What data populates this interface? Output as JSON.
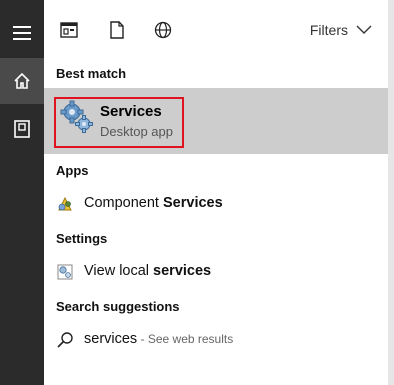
{
  "rail": {
    "items": [
      {
        "name": "menu",
        "icon": "hamburger-icon"
      },
      {
        "name": "home",
        "icon": "home-icon"
      },
      {
        "name": "documents",
        "icon": "document-icon"
      }
    ]
  },
  "topbar": {
    "tabs": [
      {
        "icon": "apps-icon"
      },
      {
        "icon": "documents-icon"
      },
      {
        "icon": "web-globe-icon"
      }
    ],
    "filters_label": "Filters"
  },
  "sections": {
    "best_match": "Best match",
    "apps": "Apps",
    "settings": "Settings",
    "search_suggestions": "Search suggestions"
  },
  "best_match": {
    "title": "Services",
    "subtitle": "Desktop app",
    "icon": "services-gears-icon"
  },
  "apps": [
    {
      "prefix": "Component ",
      "highlight": "Services",
      "icon": "component-services-icon"
    }
  ],
  "settings": [
    {
      "prefix": "View local ",
      "highlight": "services",
      "icon": "settings-services-icon"
    }
  ],
  "suggestions": [
    {
      "query": "services",
      "hint": " - See web results",
      "icon": "search-icon"
    }
  ],
  "colors": {
    "rail": "#2b2b2b",
    "rail_active": "#4a4a4a",
    "selected_bg": "#cdcdcd",
    "outline": "#e0141e"
  }
}
